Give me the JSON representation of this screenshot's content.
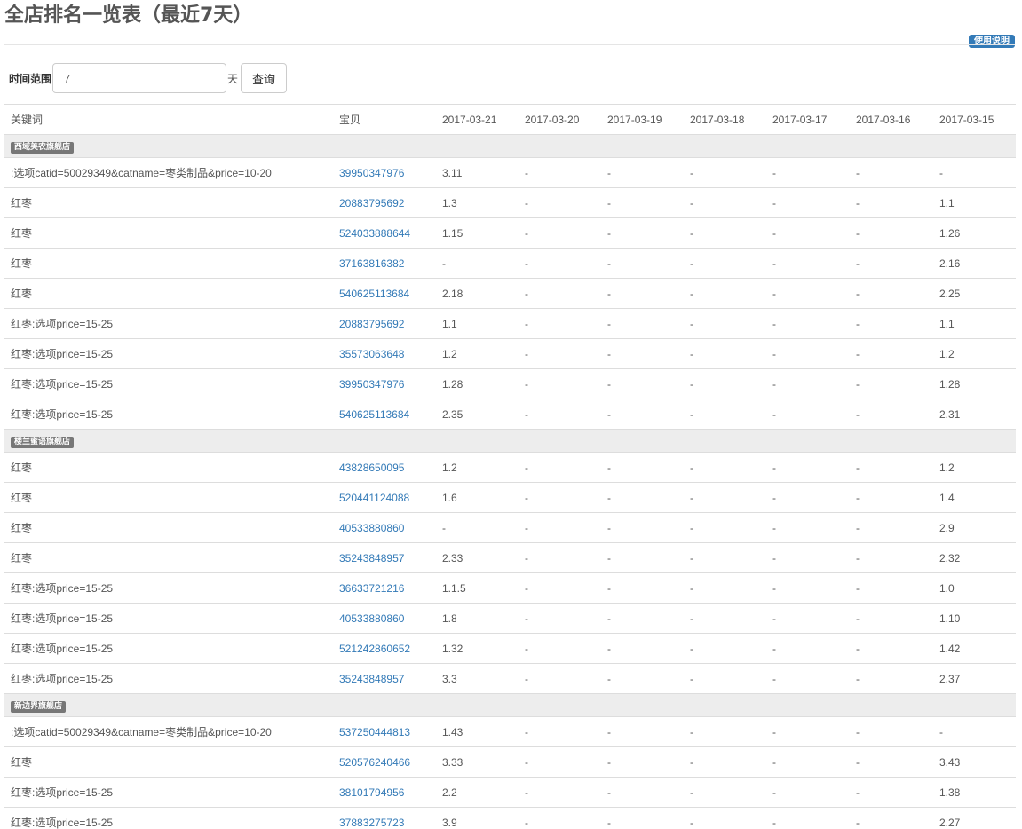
{
  "page": {
    "title": "全店排名一览表（最近7天）",
    "help_label": "使用说明"
  },
  "filter": {
    "label": "时间范围",
    "days_value": "7",
    "unit": "天",
    "query_label": "查询"
  },
  "table": {
    "headers": [
      "关键词",
      "宝贝",
      "2017-03-21",
      "2017-03-20",
      "2017-03-19",
      "2017-03-18",
      "2017-03-17",
      "2017-03-16",
      "2017-03-15"
    ],
    "groups": [
      {
        "store": "西域美农旗舰店",
        "rows": [
          {
            "keyword": ":选项catid=50029349&catname=枣类制品&price=10-20",
            "item": "39950347976",
            "ranks": [
              "3.11",
              "-",
              "-",
              "-",
              "-",
              "-",
              "-"
            ]
          },
          {
            "keyword": "红枣",
            "item": "20883795692",
            "ranks": [
              "1.3",
              "-",
              "-",
              "-",
              "-",
              "-",
              "1.1"
            ]
          },
          {
            "keyword": "红枣",
            "item": "524033888644",
            "ranks": [
              "1.15",
              "-",
              "-",
              "-",
              "-",
              "-",
              "1.26"
            ]
          },
          {
            "keyword": "红枣",
            "item": "37163816382",
            "ranks": [
              "-",
              "-",
              "-",
              "-",
              "-",
              "-",
              "2.16"
            ]
          },
          {
            "keyword": "红枣",
            "item": "540625113684",
            "ranks": [
              "2.18",
              "-",
              "-",
              "-",
              "-",
              "-",
              "2.25"
            ]
          },
          {
            "keyword": "红枣:选项price=15-25",
            "item": "20883795692",
            "ranks": [
              "1.1",
              "-",
              "-",
              "-",
              "-",
              "-",
              "1.1"
            ]
          },
          {
            "keyword": "红枣:选项price=15-25",
            "item": "35573063648",
            "ranks": [
              "1.2",
              "-",
              "-",
              "-",
              "-",
              "-",
              "1.2"
            ]
          },
          {
            "keyword": "红枣:选项price=15-25",
            "item": "39950347976",
            "ranks": [
              "1.28",
              "-",
              "-",
              "-",
              "-",
              "-",
              "1.28"
            ]
          },
          {
            "keyword": "红枣:选项price=15-25",
            "item": "540625113684",
            "ranks": [
              "2.35",
              "-",
              "-",
              "-",
              "-",
              "-",
              "2.31"
            ]
          }
        ]
      },
      {
        "store": "楼兰蜜语旗舰店",
        "rows": [
          {
            "keyword": "红枣",
            "item": "43828650095",
            "ranks": [
              "1.2",
              "-",
              "-",
              "-",
              "-",
              "-",
              "1.2"
            ]
          },
          {
            "keyword": "红枣",
            "item": "520441124088",
            "ranks": [
              "1.6",
              "-",
              "-",
              "-",
              "-",
              "-",
              "1.4"
            ]
          },
          {
            "keyword": "红枣",
            "item": "40533880860",
            "ranks": [
              "-",
              "-",
              "-",
              "-",
              "-",
              "-",
              "2.9"
            ]
          },
          {
            "keyword": "红枣",
            "item": "35243848957",
            "ranks": [
              "2.33",
              "-",
              "-",
              "-",
              "-",
              "-",
              "2.32"
            ]
          },
          {
            "keyword": "红枣:选项price=15-25",
            "item": "36633721216",
            "ranks": [
              "1.1.5",
              "-",
              "-",
              "-",
              "-",
              "-",
              "1.0"
            ]
          },
          {
            "keyword": "红枣:选项price=15-25",
            "item": "40533880860",
            "ranks": [
              "1.8",
              "-",
              "-",
              "-",
              "-",
              "-",
              "1.10"
            ]
          },
          {
            "keyword": "红枣:选项price=15-25",
            "item": "521242860652",
            "ranks": [
              "1.32",
              "-",
              "-",
              "-",
              "-",
              "-",
              "1.42"
            ]
          },
          {
            "keyword": "红枣:选项price=15-25",
            "item": "35243848957",
            "ranks": [
              "3.3",
              "-",
              "-",
              "-",
              "-",
              "-",
              "2.37"
            ]
          }
        ]
      },
      {
        "store": "新边界旗舰店",
        "rows": [
          {
            "keyword": ":选项catid=50029349&catname=枣类制品&price=10-20",
            "item": "537250444813",
            "ranks": [
              "1.43",
              "-",
              "-",
              "-",
              "-",
              "-",
              "-"
            ]
          },
          {
            "keyword": "红枣",
            "item": "520576240466",
            "ranks": [
              "3.33",
              "-",
              "-",
              "-",
              "-",
              "-",
              "3.43"
            ]
          },
          {
            "keyword": "红枣:选项price=15-25",
            "item": "38101794956",
            "ranks": [
              "2.2",
              "-",
              "-",
              "-",
              "-",
              "-",
              "1.38"
            ]
          },
          {
            "keyword": "红枣:选项price=15-25",
            "item": "37883275723",
            "ranks": [
              "3.9",
              "-",
              "-",
              "-",
              "-",
              "-",
              "2.27"
            ]
          }
        ]
      }
    ]
  }
}
